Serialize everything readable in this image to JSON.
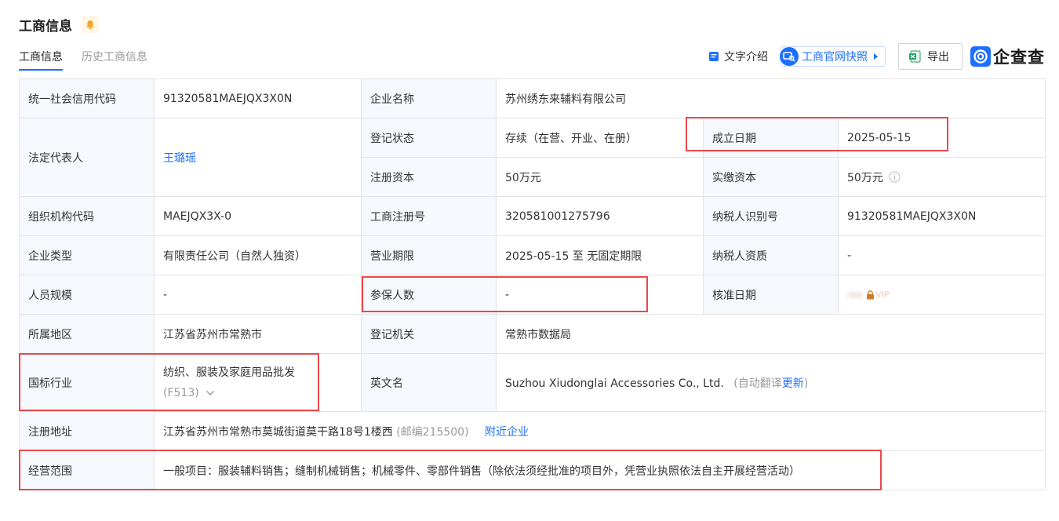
{
  "header": {
    "title": "工商信息"
  },
  "tabs": [
    {
      "label": "工商信息",
      "active": true
    },
    {
      "label": "历史工商信息",
      "active": false
    }
  ],
  "toolbar": {
    "text_intro": "文字介绍",
    "kuaizhao": "工商官网快照",
    "export": "导出",
    "logo": "企查查"
  },
  "table": {
    "credit_code": {
      "label": "统一社会信用代码",
      "value": "91320581MAEJQX3X0N"
    },
    "company_name": {
      "label": "企业名称",
      "value": "苏州绣东来辅料有限公司"
    },
    "legal_rep": {
      "label": "法定代表人",
      "value": "王璐瑶"
    },
    "reg_status": {
      "label": "登记状态",
      "value": "存续（在营、开业、在册）"
    },
    "found_date": {
      "label": "成立日期",
      "value": "2025-05-15"
    },
    "reg_capital": {
      "label": "注册资本",
      "value": "50万元"
    },
    "paid_capital": {
      "label": "实缴资本",
      "value": "50万元"
    },
    "org_code": {
      "label": "组织机构代码",
      "value": "MAEJQX3X-0"
    },
    "biz_reg_no": {
      "label": "工商注册号",
      "value": "320581001275796"
    },
    "taxpayer_id": {
      "label": "纳税人识别号",
      "value": "91320581MAEJQX3X0N"
    },
    "ent_type": {
      "label": "企业类型",
      "value": "有限责任公司（自然人独资）"
    },
    "biz_term": {
      "label": "营业期限",
      "value": "2025-05-15 至 无固定期限"
    },
    "taxpayer_qual": {
      "label": "纳税人资质",
      "value": "-"
    },
    "staff_size": {
      "label": "人员规模",
      "value": "-"
    },
    "insured": {
      "label": "参保人数",
      "value": "-"
    },
    "approval_date": {
      "label": "核准日期",
      "value": "VIP"
    },
    "region": {
      "label": "所属地区",
      "value": "江苏省苏州市常熟市"
    },
    "reg_authority": {
      "label": "登记机关",
      "value": "常熟市数据局"
    },
    "industry": {
      "label": "国标行业",
      "value": "纺织、服装及家庭用品批发",
      "code": "(F513)"
    },
    "english_name": {
      "label": "英文名",
      "value": "Suzhou Xiudonglai Accessories Co., Ltd.",
      "auto_prefix": "(自动翻译",
      "auto_link": "更新",
      "auto_suffix": ")"
    },
    "address": {
      "label": "注册地址",
      "value": "江苏省苏州市常熟市莫城街道莫干路18号1楼西",
      "postcode": "(邮编215500)",
      "nearby": "附近企业"
    },
    "scope": {
      "label": "经营范围",
      "value": "一般项目：服装辅料销售；缝制机械销售；机械零件、零部件销售（除依法须经批准的项目外，凭营业执照依法自主开展经营活动）"
    }
  },
  "colors": {
    "accent": "#1e6fff",
    "highlight_box": "#e8484b",
    "label_bg": "#f5f8fc",
    "bell": "#f5a623"
  }
}
